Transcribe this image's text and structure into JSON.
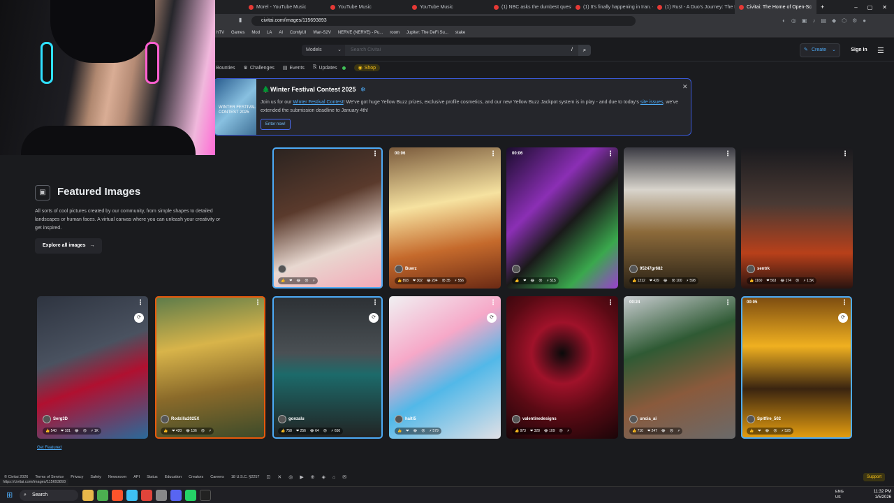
{
  "browser": {
    "tabs": [
      {
        "label": "Morel - YouTube Music",
        "active": false
      },
      {
        "label": "YouTube Music",
        "active": false
      },
      {
        "label": "YouTube Music",
        "active": false
      },
      {
        "label": "(1) NBC asks the dumbest questio",
        "active": false
      },
      {
        "label": "(1) It's finally happening in Iran. -",
        "active": false
      },
      {
        "label": "(1) Rust - A Duo's Journey: The Ri",
        "active": false
      },
      {
        "label": "Civitai: The Home of Open-Sc",
        "active": true
      }
    ],
    "url": "civitai.com/images/115693893",
    "bookmarks": [
      "hTV",
      "Games",
      "Mod",
      "LA",
      "AI",
      "ComfyUI",
      "Wan-S2V",
      "NERVE (NERVE) - Pu...",
      "room",
      "Jupiter: The DeFi Su...",
      "stake"
    ]
  },
  "header": {
    "search_scope": "Models",
    "search_placeholder": "Search Civitai",
    "search_shortcut": "/",
    "create_label": "Create",
    "signin_label": "Sign In"
  },
  "subnav": [
    "Bounties",
    "Challenges",
    "Events",
    "Updates",
    "Shop"
  ],
  "banner": {
    "image_text": "WINTER FESTIVAL CONTEST 2025",
    "title": "Winter Festival Contest 2025",
    "text_before": "Join us for our ",
    "link1": "Winter Festival Contest",
    "text_mid": "! We've got huge Yellow Buzz prizes, exclusive profile cosmetics, and our new Yellow Buzz Jackpot system is in play - and due to today's ",
    "link2": "site issues",
    "text_after": ", we've extended the submission deadline to January 4th!",
    "button": "Enter now!"
  },
  "featured": {
    "title": "Featured Images",
    "description": "All sorts of cool pictures created by our community, from simple shapes to detailed landscapes or human faces. A virtual canvas where you can unleash your creativity or get inspired.",
    "explore_label": "Explore all images",
    "get_featured": "Get Featured"
  },
  "cards": [
    {
      "user": "",
      "time": "",
      "stats": [
        "",
        "",
        "",
        "",
        ""
      ],
      "bg": "linear-gradient(160deg,#2a2320 0%,#5a3a2c 40%,#e8d8d0 70%,#f4a8b8 100%)",
      "border": "#4dabf7"
    },
    {
      "user": "Buerz",
      "time": "00:06",
      "stats": [
        "893",
        "302",
        "204",
        "35",
        "556"
      ],
      "bg": "linear-gradient(170deg,#7a5a3c 0%,#f6e2a0 40%,#c56a2c 70%,#6b2a14 100%)",
      "border": ""
    },
    {
      "user": "",
      "time": "00:06",
      "stats": [
        "",
        "",
        "",
        "",
        "515"
      ],
      "bg": "linear-gradient(135deg,#1b0d2e 0%,#8b2fb5 35%,#1a1a1a 55%,#3aa84d 80%,#9b3fd0 100%)",
      "border": ""
    },
    {
      "user": "95247gr682",
      "time": "",
      "stats": [
        "1212",
        "429",
        "",
        "100",
        "598"
      ],
      "bg": "linear-gradient(180deg,#3a3a42 0%,#d8d4cc 30%,#8c6a3a 60%,#2a2216 100%)",
      "border": ""
    },
    {
      "user": "sentrk",
      "time": "",
      "stats": [
        "1160",
        "563",
        "174",
        "",
        "1.5K"
      ],
      "bg": "linear-gradient(180deg,#1a1a1e 0%,#4a3a34 40%,#b8401a 75%,#2a1410 100%)",
      "border": ""
    },
    {
      "user": "Serg3D",
      "time": "",
      "stats": [
        "540",
        "181",
        "",
        "",
        "1K"
      ],
      "bg": "linear-gradient(160deg,#2e3440 0%,#4a5260 40%,#b01030 60%,#2a6a9a 100%)",
      "border": ""
    },
    {
      "user": "Rodzilla2025X",
      "time": "",
      "stats": [
        "",
        "420",
        "136",
        "",
        ""
      ],
      "bg": "linear-gradient(170deg,#5a7a4a 0%,#d8b44a 35%,#8a6a2a 65%,#3a4a2a 100%)",
      "border": "#e8590c"
    },
    {
      "user": "gonzalu",
      "time": "",
      "stats": [
        "758",
        "256",
        "64",
        "",
        "650"
      ],
      "bg": "linear-gradient(180deg,#2c3034 0%,#4a5054 40%,#1c6a6a 55%,#222 100%)",
      "border": "#4dabf7"
    },
    {
      "user": "haiti5",
      "time": "",
      "stats": [
        "",
        "",
        "",
        "",
        "579"
      ],
      "bg": "linear-gradient(150deg,#f0f0f2 0%,#f6a8c8 35%,#52b8e8 60%,#e0e0e6 100%)",
      "border": ""
    },
    {
      "user": "valentinedesigns",
      "time": "",
      "stats": [
        "973",
        "328",
        "109",
        "",
        ""
      ],
      "bg": "radial-gradient(circle at 50% 40%,#0a0a0a 0%,#a0122a 30%,#5a0a14 60%,#1a0508 100%)",
      "border": ""
    },
    {
      "user": "uncia_ai",
      "time": "00:24",
      "stats": [
        "710",
        "247",
        "",
        "",
        ""
      ],
      "bg": "linear-gradient(160deg,#c8ccd0 0%,#2f5a34 35%,#8a5a3c 65%,#6a6a6a 100%)",
      "border": ""
    },
    {
      "user": "Spitfire_502",
      "time": "00:05",
      "stats": [
        "",
        "",
        "",
        "",
        "528"
      ],
      "bg": "linear-gradient(180deg,#7a4a10 0%,#f0b020 35%,#3a2410 65%,#e8a010 100%)",
      "border": "#4dabf7"
    }
  ],
  "footer": {
    "links": [
      "© Civitai 2026",
      "Terms of Service",
      "Privacy",
      "Safety",
      "Newsroom",
      "API",
      "Status",
      "Education",
      "Creators",
      "Careers",
      "18 U.S.C. §2257"
    ],
    "support": "Support",
    "status_url": "https://civitai.com/images/115693893"
  },
  "taskbar": {
    "search": "Search",
    "lang1": "ENG",
    "lang2": "US",
    "time": "11:32 PM",
    "date": "1/5/2026"
  },
  "colors": {
    "accent": "#4dabf7",
    "shop": "#fcc419",
    "bg": "#1a1b1e"
  }
}
